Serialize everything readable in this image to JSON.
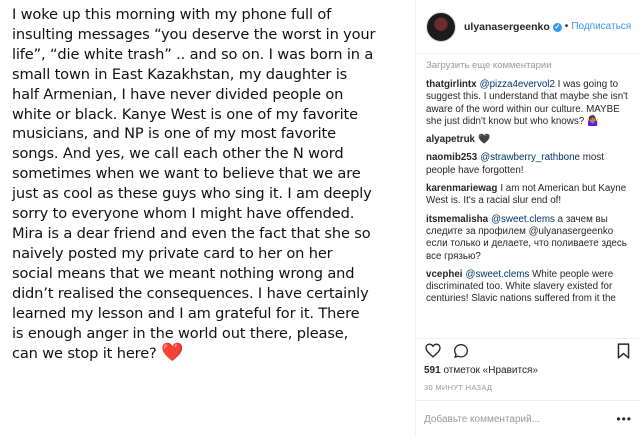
{
  "post": {
    "caption": "I woke up this morning with my phone full of\ninsulting messages “you deserve the worst in your\nlife”, “die white trash” .. and so on. I was born in a\nsmall town in East Kazakhstan, my daughter is\nhalf Armenian, I have never divided people on\nwhite or black. Kanye West is one of my favorite\nmusicians, and NP is one of my most favorite\nsongs. And yes, we call each other the N word\nsometimes when we want to believe that we are\njust as cool as these guys who sing it. I am deeply\nsorry to everyone whom I might have offended.\nMira is a dear friend and even the fact that she so\nnaively posted my private card to her on her\nsocial means that we meant nothing wrong and\ndidn’t realised the consequences. I have certainly\nlearned my lesson and I am grateful for it. There\nis enough anger in the world out there, please,\ncan we stop it here? ",
    "heart": "❤️"
  },
  "header": {
    "username": "ulyanasergeenko",
    "verified_glyph": "✓",
    "separator": "•",
    "follow_label": "Подписаться"
  },
  "comments_panel": {
    "load_more": "Загрузить еще комментарии",
    "comments": [
      {
        "user": "thatgirlintx",
        "mention": "@pizza4evervol2",
        "text": " I was going to suggest this. I understand that maybe she isn't aware of the word within our culture. MAYBE she just didn't know but who knows? 🤷🏽‍♀️"
      },
      {
        "user": "alyapetruk",
        "mention": "",
        "text": "🖤"
      },
      {
        "user": "naomib253",
        "mention": "@strawberry_rathbone",
        "text": " most people have forgotten!"
      },
      {
        "user": "karenmariewag",
        "mention": "",
        "text": "I am not American but Kayne West is. It's a racial slur end of!"
      },
      {
        "user": "itsmemalisha",
        "mention": "@sweet.clems",
        "text": " а зачем вы следите за профилем @ulyanasergeenko если только и делаете, что поливаете здесь все грязью?"
      },
      {
        "user": "vcephei",
        "mention": "@sweet.clems",
        "text": " White people were discriminated too. White slavery existed for centuries! Slavic nations suffered from it the"
      }
    ]
  },
  "footer": {
    "likes_count": "591",
    "likes_text": "отметок «Нравится»",
    "timestamp": "30 МИНУТ НАЗАД",
    "comment_placeholder": "Добавьте комментарий...",
    "more_glyph": "•••"
  },
  "icons": [
    "heart-outline-icon",
    "comment-icon",
    "share-icon",
    "bookmark-icon"
  ],
  "colors": {
    "accent": "#3897f0",
    "mention": "#003569",
    "heart": "#e0303a",
    "muted": "#999999"
  }
}
